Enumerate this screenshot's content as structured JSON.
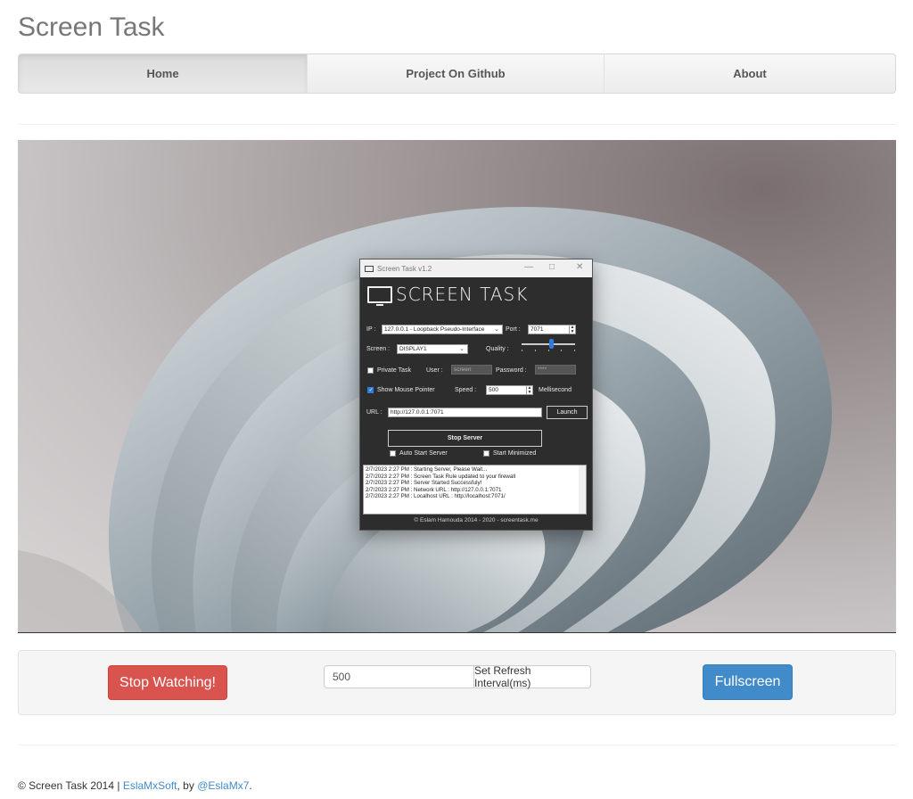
{
  "app": {
    "title": "Screen Task"
  },
  "nav": {
    "items": [
      {
        "label": "Home"
      },
      {
        "label": "Project On Github"
      },
      {
        "label": "About"
      }
    ]
  },
  "remote_window": {
    "title": "Screen Task v1.2",
    "logo_text": "SCREEN TASK",
    "ip_label": "IP :",
    "ip_value": "127.0.0.1 - Loopback Pseudo-Interface",
    "port_label": "Port :",
    "port_value": "7071",
    "screen_label": "Screen :",
    "screen_value": "DISPLAY1",
    "quality_label": "Quality :",
    "quality_level_fraction": 0.6,
    "private_task_label": "Private Task",
    "private_task_checked": false,
    "user_label": "User :",
    "user_value": "screen",
    "password_label": "Password :",
    "password_value": "****",
    "show_mouse_label": "Show Mouse Pointer",
    "show_mouse_checked": true,
    "speed_label": "Speed :",
    "speed_value": "500",
    "speed_unit": "Mellisecond",
    "url_label": "URL :",
    "url_value": "http://127.0.0.1:7071",
    "launch_label": "Launch",
    "stop_server_label": "Stop Server",
    "auto_start_label": "Auto Start Server",
    "start_minimized_label": "Start Minimized",
    "log": [
      "2/7/2023 2:27 PM : Starting Server, Please Wait...",
      "2/7/2023 2:27 PM : Screen Task Rule updated to your firewall",
      "2/7/2023 2:27 PM : Server Started Successfuly!",
      "2/7/2023 2:27 PM : Network URL : http://127.0.0.1:7071",
      "2/7/2023 2:27 PM : Localhost URL : http://localhost:7071/"
    ],
    "footer": "© Eslam Hamouda 2014 - 2020 - screentask.me"
  },
  "controls": {
    "stop_label": "Stop Watching!",
    "interval_value": "500",
    "interval_button": "Set Refresh Interval(ms)",
    "fullscreen_label": "Fullscreen"
  },
  "footer": {
    "prefix": "© Screen Task 2014 | ",
    "link1": "EslaMxSoft",
    "middle": ", by ",
    "link2": "@EslaMx7",
    "suffix": "."
  },
  "colors": {
    "danger": "#d9534f",
    "primary": "#428bca",
    "link": "#428bca"
  }
}
